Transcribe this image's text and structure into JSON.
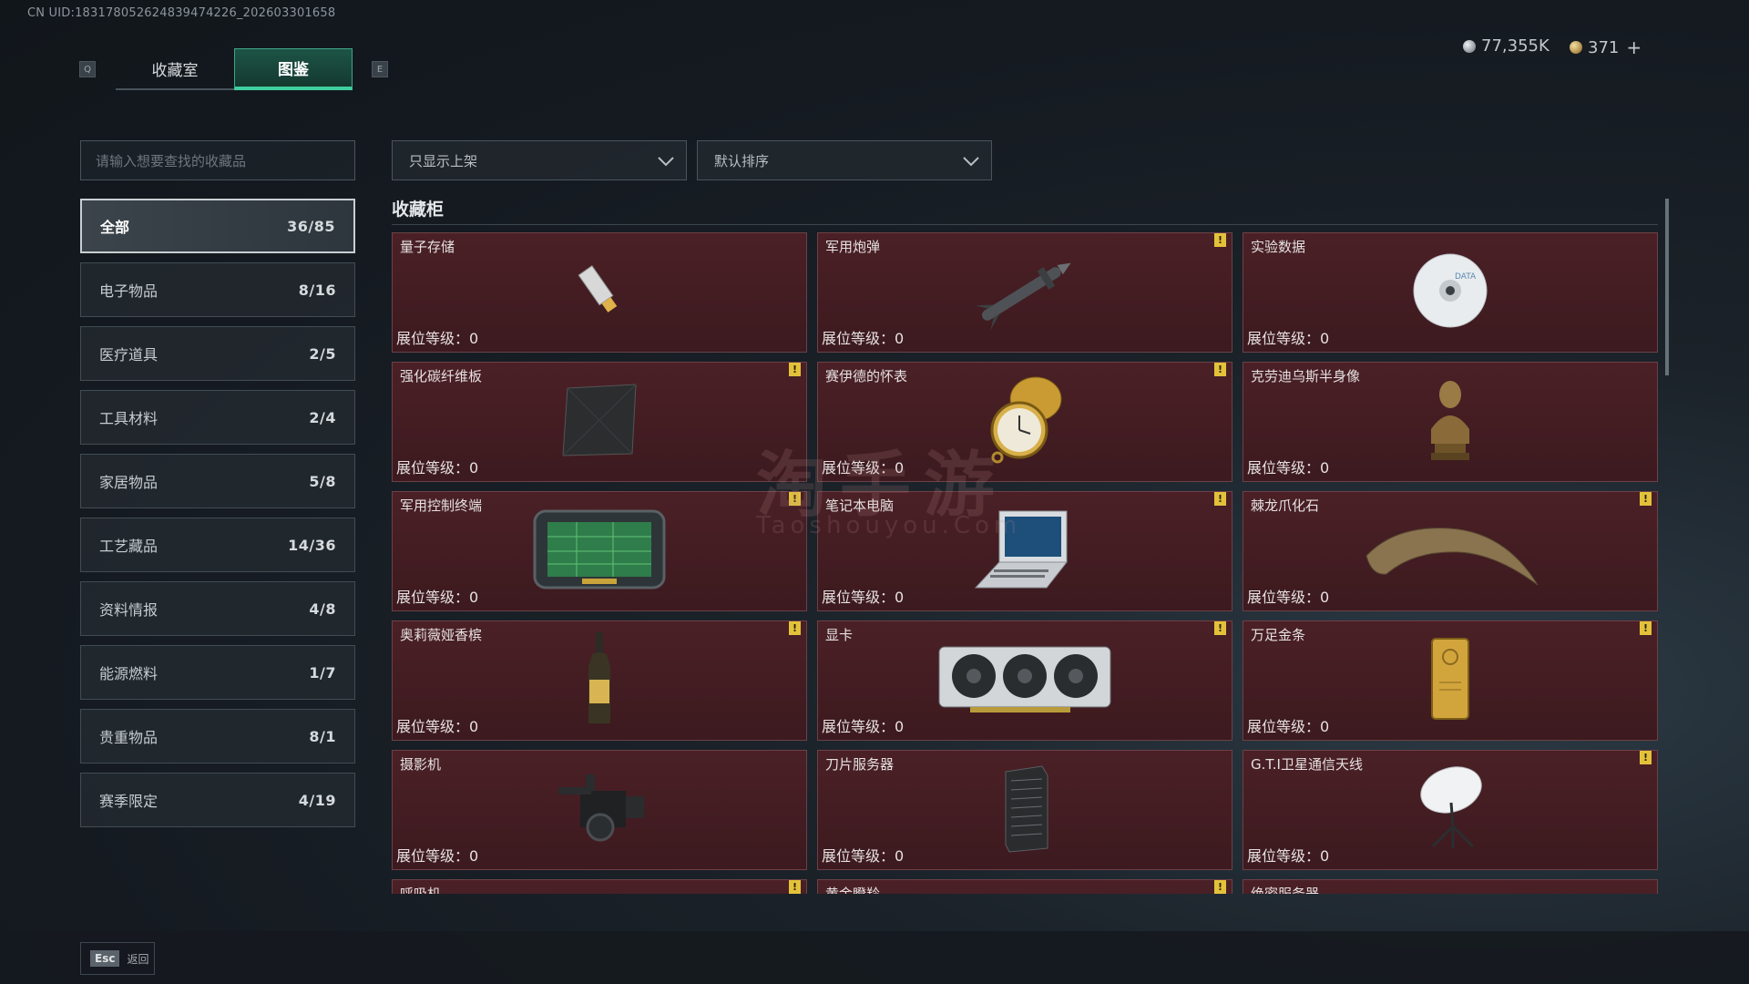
{
  "uid": "CN UID:1831780526248394742​26_202603301658",
  "keys": {
    "left": "Q",
    "right": "E"
  },
  "tabs": [
    {
      "label": "收藏室",
      "active": false
    },
    {
      "label": "图鉴",
      "active": true
    }
  ],
  "currency": {
    "silver": "77,355K",
    "gold": "371",
    "plus": "+"
  },
  "search": {
    "placeholder": "请输入想要查找的收藏品"
  },
  "filters": {
    "shelf": "只显示上架",
    "sort": "默认排序"
  },
  "categories": [
    {
      "label": "全部",
      "count": "36/85",
      "active": true
    },
    {
      "label": "电子物品",
      "count": "8/16"
    },
    {
      "label": "医疗道具",
      "count": "2/5"
    },
    {
      "label": "工具材料",
      "count": "2/4"
    },
    {
      "label": "家居物品",
      "count": "5/8"
    },
    {
      "label": "工艺藏品",
      "count": "14/36"
    },
    {
      "label": "资料情报",
      "count": "4/8"
    },
    {
      "label": "能源燃料",
      "count": "1/7"
    },
    {
      "label": "贵重物品",
      "count": "8/1"
    },
    {
      "label": "赛季限定",
      "count": "4/19"
    }
  ],
  "section_title": "收藏柜",
  "level_label": "展位等级：",
  "items": [
    {
      "name": "量子存储",
      "level": "0",
      "warn": false,
      "icon": "usb-drive-icon"
    },
    {
      "name": "军用炮弹",
      "level": "0",
      "warn": true,
      "icon": "missile-icon"
    },
    {
      "name": "实验数据",
      "level": "0",
      "warn": false,
      "icon": "disc-icon"
    },
    {
      "name": "强化碳纤维板",
      "level": "0",
      "warn": true,
      "icon": "carbon-plate-icon"
    },
    {
      "name": "赛伊德的怀表",
      "level": "0",
      "warn": true,
      "icon": "pocket-watch-icon"
    },
    {
      "name": "克劳迪乌斯半身像",
      "level": "0",
      "warn": false,
      "icon": "bust-icon"
    },
    {
      "name": "军用控制终端",
      "level": "0",
      "warn": true,
      "icon": "terminal-icon"
    },
    {
      "name": "笔记本电脑",
      "level": "0",
      "warn": true,
      "icon": "laptop-icon"
    },
    {
      "name": "棘龙爪化石",
      "level": "0",
      "warn": true,
      "icon": "claw-fossil-icon"
    },
    {
      "name": "奥莉薇娅香槟",
      "level": "0",
      "warn": true,
      "icon": "champagne-icon"
    },
    {
      "name": "显卡",
      "level": "0",
      "warn": true,
      "icon": "gpu-icon"
    },
    {
      "name": "万足金条",
      "level": "0",
      "warn": true,
      "icon": "gold-bar-icon"
    },
    {
      "name": "摄影机",
      "level": "0",
      "warn": false,
      "icon": "camera-icon"
    },
    {
      "name": "刀片服务器",
      "level": "0",
      "warn": false,
      "icon": "server-icon"
    },
    {
      "name": "G.T.I卫星通信天线",
      "level": "0",
      "warn": true,
      "icon": "satellite-dish-icon"
    },
    {
      "name": "呼吸机",
      "level": "",
      "warn": true,
      "icon": ""
    },
    {
      "name": "黄金瞪羚",
      "level": "",
      "warn": true,
      "icon": ""
    },
    {
      "name": "绝密服务器",
      "level": "",
      "warn": false,
      "icon": ""
    }
  ],
  "watermark": {
    "main": "淘手游",
    "sub": "Taoshouyou.Com"
  },
  "footer": {
    "key": "Esc",
    "label": "返回"
  }
}
